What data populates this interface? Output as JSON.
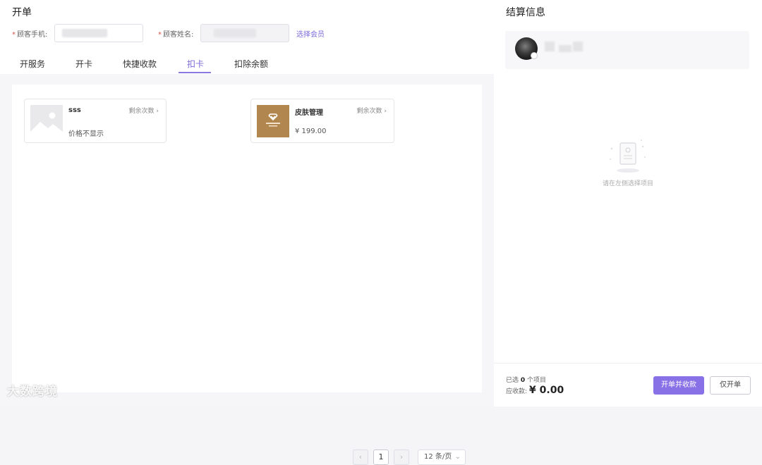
{
  "order": {
    "title": "开单",
    "phone_label": "顾客手机:",
    "name_label": "顾客姓名:",
    "select_member_link": "选择会员",
    "required_mark": "*"
  },
  "tabs": [
    {
      "label": "开服务"
    },
    {
      "label": "开卡"
    },
    {
      "label": "快捷收款"
    },
    {
      "label": "扣卡",
      "active": true
    },
    {
      "label": "扣除余额"
    }
  ],
  "cards": [
    {
      "name": "sss",
      "remain_label": "剩余次数",
      "price": "价格不显示",
      "thumb": "placeholder-image"
    },
    {
      "name": "皮肤管理",
      "remain_label": "剩余次数",
      "price": "¥ 199.00",
      "thumb": "brand-logo"
    }
  ],
  "pagination": {
    "prev_icon": "‹",
    "page": "1",
    "next_icon": "›",
    "page_size": "12 条/页"
  },
  "settlement": {
    "title": "结算信息",
    "empty_text": "请在左侧选择项目",
    "selected_prefix": "已选",
    "selected_count": "0",
    "selected_suffix": "个项目",
    "due_label": "应收款:",
    "due_amount": "¥ 0.00",
    "checkout_button": "开单并收款",
    "order_only_button": "仅开单"
  },
  "watermark": "大数跨境",
  "colors": {
    "accent": "#7a6bd8",
    "primary_button": "#8870e6",
    "card_thumb_brown": "#b2864f"
  }
}
